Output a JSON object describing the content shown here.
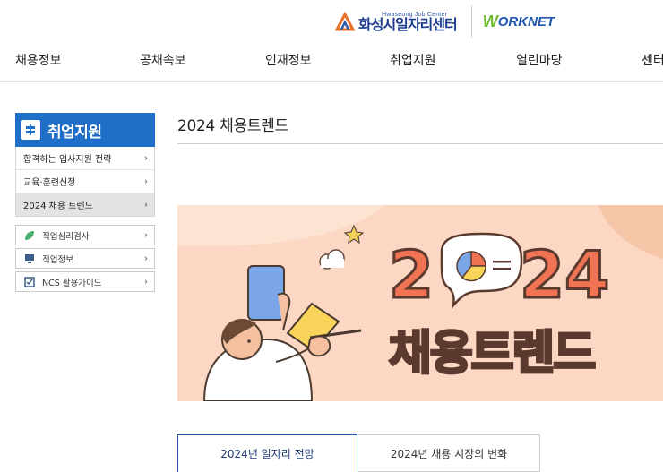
{
  "header": {
    "logo_sub": "Hwaseong Job Center",
    "logo_main": "화성시일자리센터",
    "worknet_w": "W",
    "worknet_rest": "ORKNET"
  },
  "gnb": [
    "채용정보",
    "공채속보",
    "인재정보",
    "취업지원",
    "열린마당",
    "센터"
  ],
  "lnb": {
    "title": "취업지원",
    "items": [
      {
        "label": "합격하는 입사지원 전략",
        "active": false
      },
      {
        "label": "교육·훈련신청",
        "active": false
      },
      {
        "label": "2024 채용 트렌드",
        "active": true
      }
    ],
    "sub_items": [
      {
        "label": "직업심리검사",
        "icon": "leaf-icon"
      },
      {
        "label": "직업정보",
        "icon": "monitor-icon"
      },
      {
        "label": "NCS 활용가이드",
        "icon": "checkbox-icon"
      }
    ]
  },
  "content": {
    "title": "2024 채용트렌드",
    "banner": {
      "year_left": "2",
      "year_right": "24",
      "headline": "채용트렌드"
    },
    "tabs": [
      "2024년 일자리 전망",
      "2024년 채용 시장의 변화"
    ]
  },
  "colors": {
    "primary": "#1f6fc8",
    "banner_bg": "#fbd7c4",
    "banner_orange": "#f07353",
    "banner_cream": "#fbe7b5"
  }
}
